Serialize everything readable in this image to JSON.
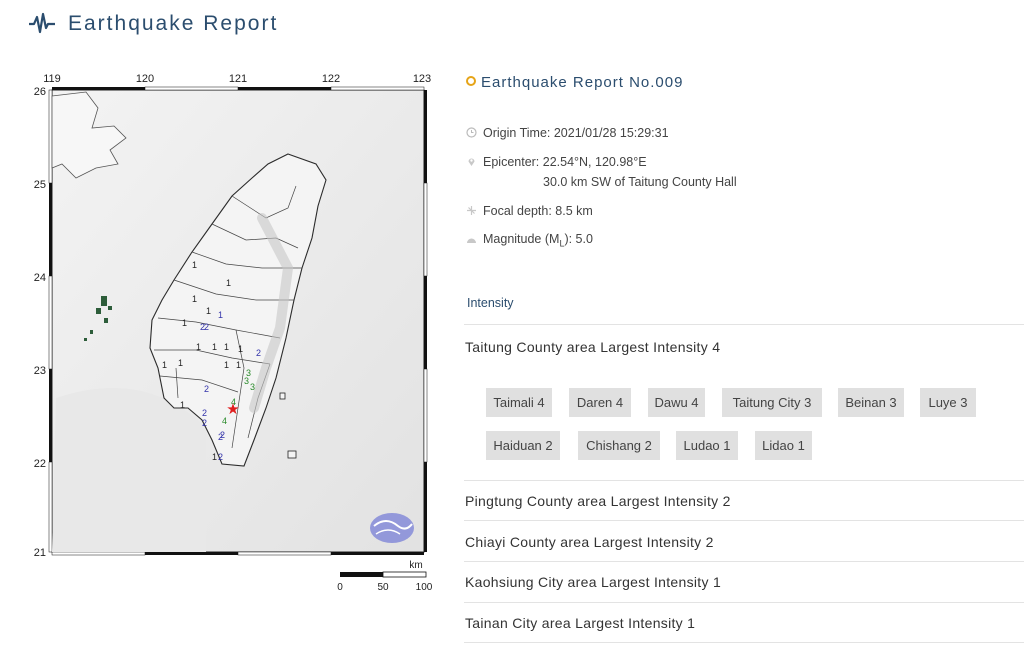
{
  "header": {
    "title": "Earthquake Report",
    "icon": "seismograph-icon",
    "accent": "#2b4d6e"
  },
  "map": {
    "lon_ticks": [
      "119",
      "120",
      "121",
      "122",
      "123"
    ],
    "lat_ticks": [
      "26",
      "25",
      "24",
      "23",
      "22",
      "21"
    ],
    "scale_unit": "km",
    "scale_labels": [
      "0",
      "50",
      "100"
    ],
    "intensity_marks": [
      {
        "v": "1",
        "c": "#222"
      },
      {
        "v": "1",
        "c": "#222"
      },
      {
        "v": "1",
        "c": "#222"
      },
      {
        "v": "1",
        "c": "#222"
      },
      {
        "v": "2",
        "c": "#3333aa"
      },
      {
        "v": "1",
        "c": "#3333aa"
      },
      {
        "v": "1",
        "c": "#222"
      },
      {
        "v": "1",
        "c": "#222"
      },
      {
        "v": "1",
        "c": "#222"
      },
      {
        "v": "1",
        "c": "#222"
      },
      {
        "v": "2",
        "c": "#3333aa"
      },
      {
        "v": "1",
        "c": "#222"
      },
      {
        "v": "1",
        "c": "#222"
      },
      {
        "v": "1",
        "c": "#222"
      },
      {
        "v": "2",
        "c": "#3333aa"
      },
      {
        "v": "3",
        "c": "#2a8a2a"
      },
      {
        "v": "3",
        "c": "#2a8a2a"
      },
      {
        "v": "3",
        "c": "#2a8a2a"
      },
      {
        "v": "2",
        "c": "#3333aa"
      },
      {
        "v": "1",
        "c": "#222"
      },
      {
        "v": "2",
        "c": "#3333aa"
      },
      {
        "v": "4",
        "c": "#2a8a2a"
      },
      {
        "v": "2",
        "c": "#3333aa"
      },
      {
        "v": "4",
        "c": "#2a8a2a"
      },
      {
        "v": "2",
        "c": "#3333aa"
      },
      {
        "v": "2",
        "c": "#3333aa"
      },
      {
        "v": "1",
        "c": "#222"
      },
      {
        "v": "2",
        "c": "#3333aa"
      },
      {
        "v": "1",
        "c": "#222"
      },
      {
        "v": "1",
        "c": "#222"
      }
    ]
  },
  "report": {
    "title": "Earthquake Report No.009",
    "origin_time": "Origin Time: 2021/01/28 15:29:31",
    "epicenter": "Epicenter: 22.54°N, 120.98°E",
    "epicenter_sub": "30.0 km SW of Taitung County Hall",
    "focal_depth": "Focal depth: 8.5 km",
    "magnitude_prefix": "Magnitude (M",
    "magnitude_sub": "L",
    "magnitude_suffix": "): 5.0"
  },
  "intensity": {
    "label": "Intensity",
    "expanded": {
      "title": "Taitung County area Largest Intensity 4",
      "stations": [
        "Taimali 4",
        "Daren 4",
        "Dawu 4",
        "Taitung City 3",
        "Beinan 3",
        "Luye 3",
        "Haiduan 2",
        "Chishang 2",
        "Ludao 1",
        "Lidao 1"
      ]
    },
    "areas": [
      "Pingtung County area Largest Intensity 2",
      "Chiayi County area Largest Intensity 2",
      "Kaohsiung City area Largest Intensity 1",
      "Tainan City area Largest Intensity 1"
    ]
  }
}
